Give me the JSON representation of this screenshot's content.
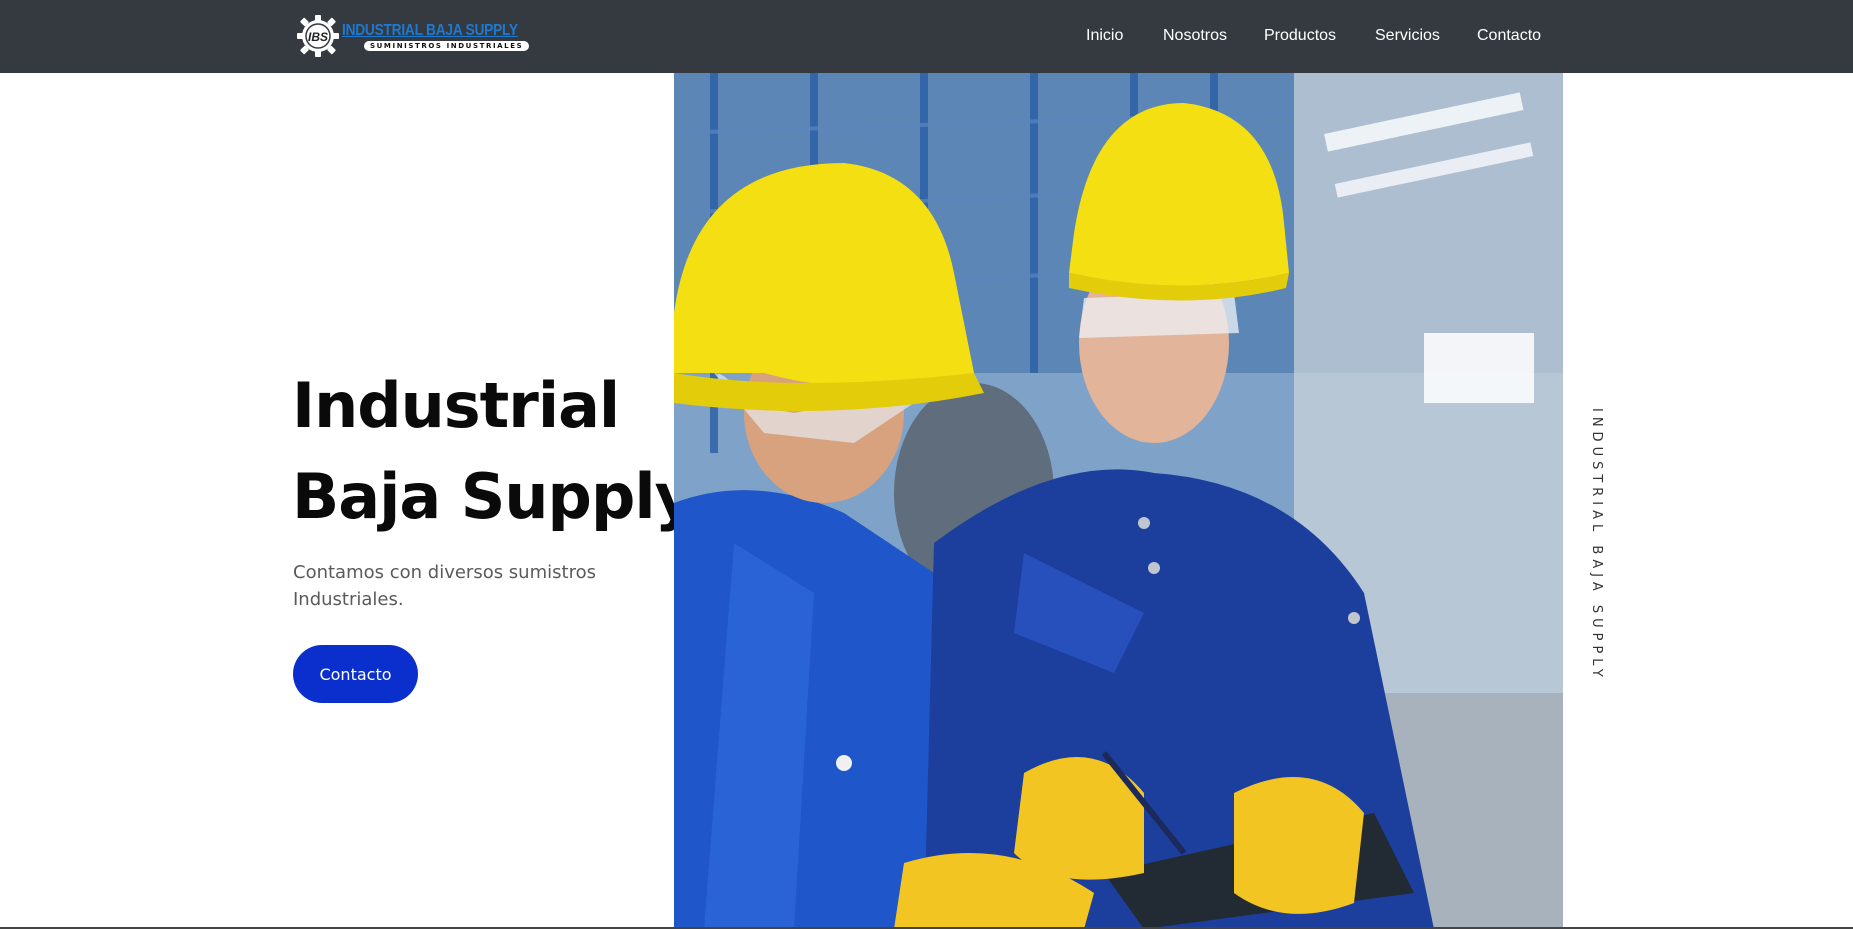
{
  "brand": {
    "logo_initials": "IBS",
    "name": "INDUSTRIAL BAJA SUPPLY",
    "tagline": "SUMINISTROS INDUSTRIALES",
    "accent_color": "#1e7ad1"
  },
  "nav": {
    "items": [
      {
        "label": "Inicio"
      },
      {
        "label": "Nosotros"
      },
      {
        "label": "Productos"
      },
      {
        "label": "Servicios"
      },
      {
        "label": "Contacto"
      }
    ]
  },
  "hero": {
    "title_line1": "Industrial",
    "title_line2": "Baja Supply",
    "subtitle": "Contamos con diversos sumistros Industriales.",
    "cta_label": "Contacto",
    "cta_color": "#0a2fcc",
    "image_icon": "workers-photo"
  },
  "side": {
    "vertical_text": "INDUSTRIAL BAJA SUPPLY"
  },
  "colors": {
    "header_bg": "#343a40",
    "title": "#0a0a0a"
  }
}
